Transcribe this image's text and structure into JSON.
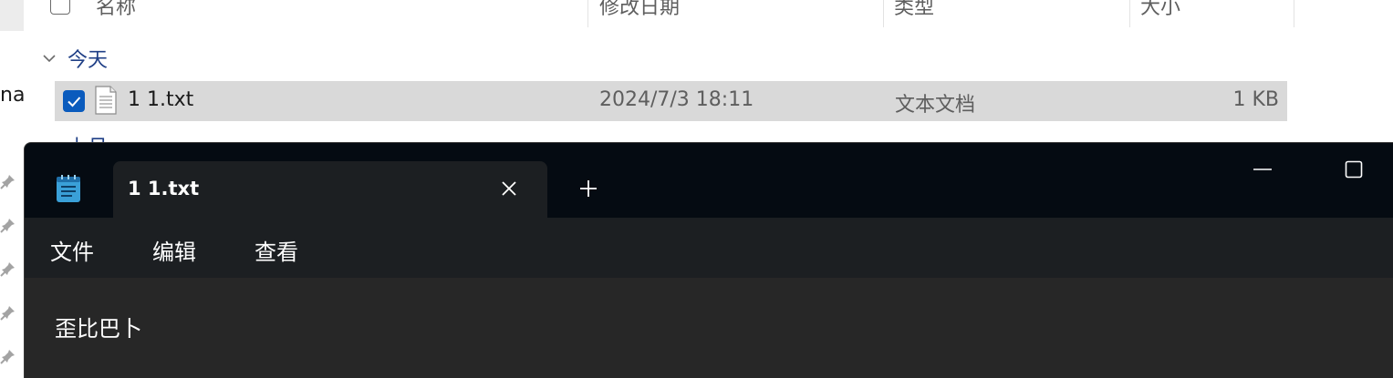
{
  "explorer": {
    "columns": [
      "名称",
      "修改日期",
      "类型",
      "大小"
    ],
    "group_today": "今天",
    "group_lastmonth": "上月",
    "left_partial_text": "na",
    "file": {
      "name": "1 1.txt",
      "modified": "2024/7/3 18:11",
      "type": "文本文档",
      "size": "1 KB",
      "selected": true
    },
    "colors": {
      "group_label": "#1f3f86",
      "selection": "#d9d9d9",
      "checkbox": "#0a5bbd"
    }
  },
  "notepad": {
    "tab_title": "1 1.txt",
    "menu": [
      "文件",
      "编辑",
      "查看"
    ],
    "content": "歪比巴卜",
    "icons": [
      "notepad-app-icon",
      "close-icon",
      "plus-icon",
      "minimize-icon",
      "maximize-icon"
    ],
    "colors": {
      "titlebar": "#050b12",
      "tab": "#1c1f22",
      "editor": "#272727"
    }
  }
}
